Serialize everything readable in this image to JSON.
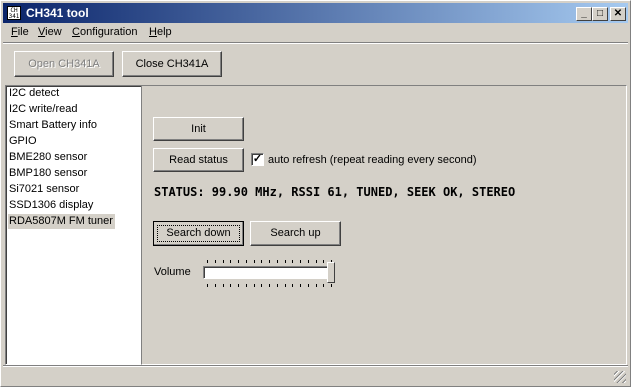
{
  "window": {
    "title": "CH341 tool",
    "icon_text": "CH\n341",
    "minimize_glyph": "_",
    "maximize_glyph": "□",
    "close_glyph": "✕"
  },
  "menu": [
    {
      "label": "File",
      "accel": "F",
      "rest": "ile"
    },
    {
      "label": "View",
      "accel": "V",
      "rest": "iew"
    },
    {
      "label": "Configuration",
      "accel": "C",
      "rest": "onfiguration"
    },
    {
      "label": "Help",
      "accel": "H",
      "rest": "elp"
    }
  ],
  "toolbar": {
    "open_label": "Open CH341A",
    "close_label": "Close CH341A"
  },
  "sidebar": {
    "items": [
      {
        "label": "I2C detect"
      },
      {
        "label": "I2C write/read"
      },
      {
        "label": "Smart Battery info"
      },
      {
        "label": "GPIO"
      },
      {
        "label": "BME280 sensor"
      },
      {
        "label": "BMP180 sensor"
      },
      {
        "label": "Si7021 sensor"
      },
      {
        "label": "SSD1306 display"
      },
      {
        "label": "RDA5807M FM tuner"
      }
    ],
    "selected_index": 8
  },
  "panel": {
    "init_label": "Init",
    "read_status_label": "Read status",
    "auto_refresh_label": "auto refresh (repeat reading every second)",
    "auto_refresh_checked": true,
    "check_glyph": "✓",
    "status_text": "STATUS: 99.90 MHz, RSSI 61, TUNED, SEEK OK, STEREO",
    "search_down_label": "Search down",
    "search_up_label": "Search up",
    "volume_label": "Volume",
    "volume_level": 1.0
  }
}
